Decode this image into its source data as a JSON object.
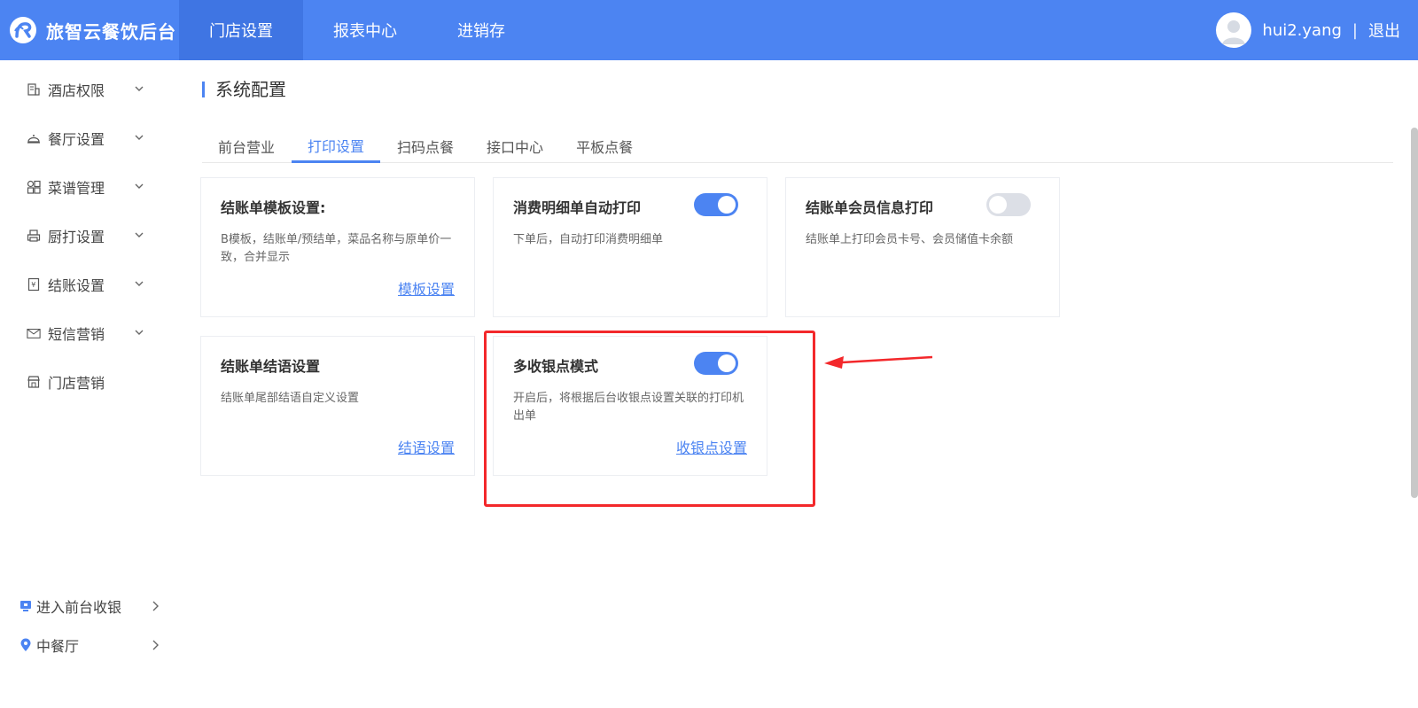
{
  "brand": {
    "name": "旅智云餐饮后台"
  },
  "topnav": [
    {
      "label": "门店设置",
      "active": true
    },
    {
      "label": "报表中心",
      "active": false
    },
    {
      "label": "进销存",
      "active": false
    }
  ],
  "user": {
    "name": "hui2.yang",
    "separator": "|",
    "logout": "退出"
  },
  "sidebar": {
    "items": [
      {
        "label": "酒店权限",
        "icon": "building-icon"
      },
      {
        "label": "餐厅设置",
        "icon": "cloche-icon"
      },
      {
        "label": "菜谱管理",
        "icon": "grid-icon"
      },
      {
        "label": "厨打设置",
        "icon": "printer-icon"
      },
      {
        "label": "结账设置",
        "icon": "receipt-icon"
      },
      {
        "label": "短信营销",
        "icon": "mail-icon"
      },
      {
        "label": "门店营销",
        "icon": "store-icon"
      }
    ],
    "bottom": [
      {
        "label": "进入前台收银",
        "icon": "monitor-icon"
      },
      {
        "label": "中餐厅",
        "icon": "location-pin-icon"
      }
    ]
  },
  "page": {
    "title": "系统配置"
  },
  "tabs": [
    {
      "label": "前台营业",
      "active": false
    },
    {
      "label": "打印设置",
      "active": true
    },
    {
      "label": "扫码点餐",
      "active": false
    },
    {
      "label": "接口中心",
      "active": false
    },
    {
      "label": "平板点餐",
      "active": false
    }
  ],
  "cards": {
    "template": {
      "title": "结账单模板设置:",
      "desc": "B模板，结账单/预结单，菜品名称与原单价一致，合并显示",
      "link": "模板设置"
    },
    "detail_print": {
      "title": "消费明细单自动打印",
      "desc": "下单后，自动打印消费明细单",
      "toggle_on": true
    },
    "member_print": {
      "title": "结账单会员信息打印",
      "desc": "结账单上打印会员卡号、会员储值卡余额",
      "toggle_on": false
    },
    "closing": {
      "title": "结账单结语设置",
      "desc": "结账单尾部结语自定义设置",
      "link": "结语设置"
    },
    "multi_cashier": {
      "title": "多收银点模式",
      "desc": "开启后，将根据后台收银点设置关联的打印机出单",
      "link": "收银点设置",
      "toggle_on": true
    }
  },
  "colors": {
    "primary": "#4c84f2",
    "highlight": "#f3282b"
  }
}
